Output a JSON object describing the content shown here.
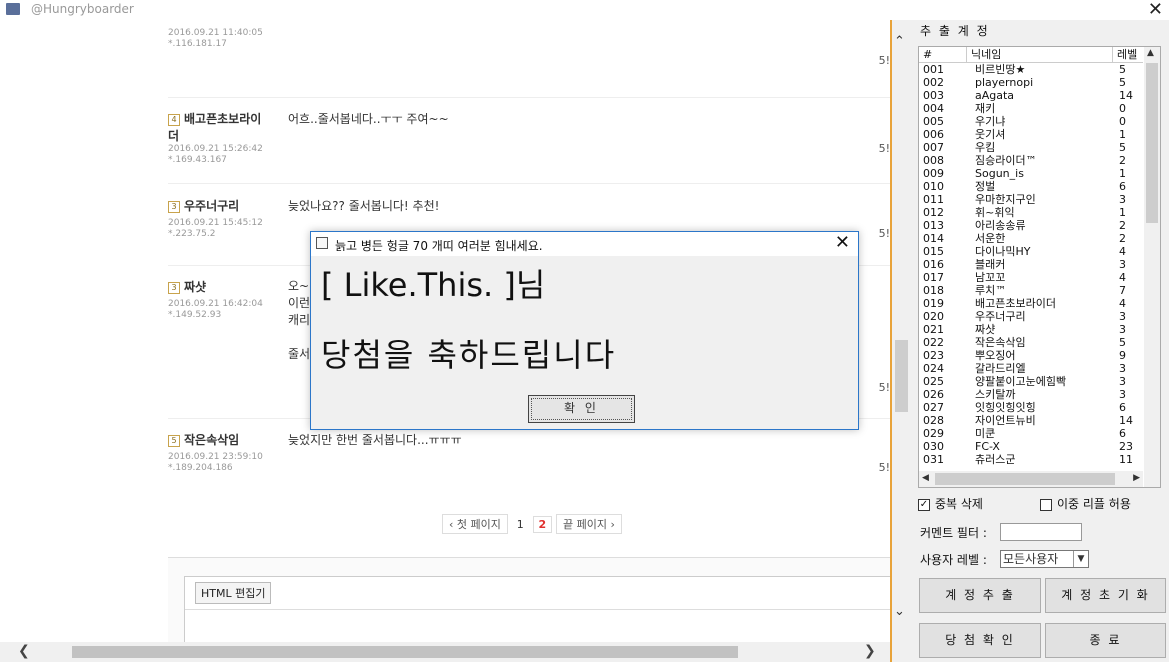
{
  "window": {
    "title": "@Hungryboarder",
    "close_glyph": "✕"
  },
  "comments": [
    {
      "rank": "",
      "author": "",
      "date": "2016.09.21 11:40:05",
      "ip": "*.116.181.17",
      "text": "",
      "side": "5!"
    },
    {
      "rank": "4",
      "author": "배고픈초보라이",
      "author2": "더",
      "date": "2016.09.21 15:26:42",
      "ip": "*.169.43.167",
      "text": "어흐..줄서봅네다..ㅜㅜ 주여~~",
      "side": "5!"
    },
    {
      "rank": "3",
      "author": "우주너구리",
      "date": "2016.09.21 15:45:12",
      "ip": "*.223.75.2",
      "text": "늦었나요?? 줄서봅니다! 추천!",
      "side": "5!"
    },
    {
      "rank": "3",
      "author": "짜샷",
      "date": "2016.09.21 16:42:04",
      "ip": "*.149.52.93",
      "text_lines": [
        "오~",
        "이런",
        "캐리",
        "",
        "줄서"
      ],
      "side": "5!"
    },
    {
      "rank": "5",
      "author": "작은속삭임",
      "date": "2016.09.21 23:59:10",
      "ip": "*.189.204.186",
      "text": "늦었지만 한번 줄서봅니다...ㅠㅠㅠ",
      "side": "5!"
    }
  ],
  "pager": {
    "first": "‹ 첫 페이지",
    "p1": "1",
    "p2": "2",
    "last": "끝 페이지 ›"
  },
  "editor": {
    "html_button": "HTML 편집기"
  },
  "panel": {
    "title": "추 출 계 정",
    "columns": [
      "#",
      "닉네임",
      "레벨"
    ],
    "accounts": [
      {
        "no": "001",
        "nick": "비르빈땅★",
        "lv": "5"
      },
      {
        "no": "002",
        "nick": "playernopi",
        "lv": "5"
      },
      {
        "no": "003",
        "nick": "aAgata",
        "lv": "14"
      },
      {
        "no": "004",
        "nick": "재키",
        "lv": "0"
      },
      {
        "no": "005",
        "nick": "우기냐",
        "lv": "0"
      },
      {
        "no": "006",
        "nick": "웃기셔",
        "lv": "1"
      },
      {
        "no": "007",
        "nick": "우킴",
        "lv": "5"
      },
      {
        "no": "008",
        "nick": "짐승라이더™",
        "lv": "2"
      },
      {
        "no": "009",
        "nick": "Sogun_is",
        "lv": "1"
      },
      {
        "no": "010",
        "nick": "정벌",
        "lv": "6"
      },
      {
        "no": "011",
        "nick": "우마한지구인",
        "lv": "3"
      },
      {
        "no": "012",
        "nick": "휘~휘익",
        "lv": "1"
      },
      {
        "no": "013",
        "nick": "아리송송류",
        "lv": "2"
      },
      {
        "no": "014",
        "nick": "서운한",
        "lv": "2"
      },
      {
        "no": "015",
        "nick": "다이나믹HY",
        "lv": "4"
      },
      {
        "no": "016",
        "nick": "블래커",
        "lv": "3"
      },
      {
        "no": "017",
        "nick": "남꼬꼬",
        "lv": "4"
      },
      {
        "no": "018",
        "nick": "루치™",
        "lv": "7"
      },
      {
        "no": "019",
        "nick": "배고픈초보라이더",
        "lv": "4"
      },
      {
        "no": "020",
        "nick": "우주너구리",
        "lv": "3"
      },
      {
        "no": "021",
        "nick": "짜샷",
        "lv": "3"
      },
      {
        "no": "022",
        "nick": "작은속삭임",
        "lv": "5"
      },
      {
        "no": "023",
        "nick": "뿌오징어",
        "lv": "9"
      },
      {
        "no": "024",
        "nick": "갈라드리엘",
        "lv": "3"
      },
      {
        "no": "025",
        "nick": "양팔붙이고눈에힘빡",
        "lv": "3"
      },
      {
        "no": "026",
        "nick": "스키탈까",
        "lv": "3"
      },
      {
        "no": "027",
        "nick": "잇힝잇힝잇힝",
        "lv": "6"
      },
      {
        "no": "028",
        "nick": "자이언트뉴비",
        "lv": "14"
      },
      {
        "no": "029",
        "nick": "미쿤",
        "lv": "6"
      },
      {
        "no": "030",
        "nick": "FC-X",
        "lv": "23"
      },
      {
        "no": "031",
        "nick": "츄러스군",
        "lv": "11"
      }
    ],
    "dup_delete": {
      "label": "중복 삭제",
      "checked": true
    },
    "double_reply": {
      "label": "이중 리플 허용",
      "checked": false
    },
    "comment_filter_label": "커멘트 필터 :",
    "comment_filter_value": "",
    "user_level_label": "사용자 레벨 :",
    "user_level_value": "모든사용자",
    "btn_extract": "계 정 추 출",
    "btn_reset": "계 정 초 기 화",
    "btn_confirm": "당 첨 확 인",
    "btn_exit": "종 료"
  },
  "dialog": {
    "title": "늙고 병든 헝글 70 개띠 여러분 힘내세요.",
    "line1": "[ Like.This. ]님",
    "line2": "당첨을 축하드립니다",
    "ok": "확 인",
    "close_glyph": "✕"
  }
}
